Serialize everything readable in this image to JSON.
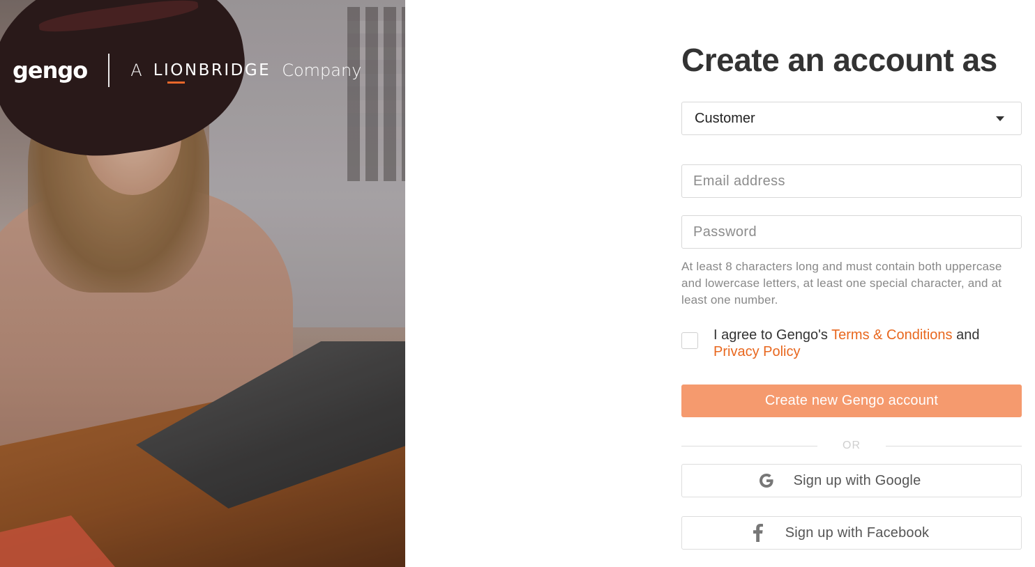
{
  "brand": {
    "logo_text": "gengo",
    "a_text": "A",
    "lionbridge_text": "LIONBRIDGE",
    "company_text": "Company",
    "accent_color": "#e8672a"
  },
  "hero": {
    "image_alt": "Woman in a hat smiling while using a laptop at a wooden desk"
  },
  "form": {
    "title": "Create an account as",
    "account_type": {
      "selected": "Customer"
    },
    "email": {
      "placeholder": "Email address",
      "value": ""
    },
    "password": {
      "placeholder": "Password",
      "value": ""
    },
    "password_hint": "At least 8 characters long and must contain both uppercase and lowercase letters, at least one special character, and at least one number.",
    "agree": {
      "checked": false,
      "prefix": "I agree to Gengo's ",
      "terms_link": "Terms & Conditions",
      "middle": " and",
      "privacy_link": "Privacy Policy"
    },
    "submit_label": "Create new Gengo account",
    "submit_color": "#f59a6e",
    "or_label": "OR",
    "google_label": "Sign up with Google",
    "google_icon": "google-g-icon",
    "facebook_label": "Sign up with Facebook",
    "facebook_icon": "facebook-f-icon"
  }
}
